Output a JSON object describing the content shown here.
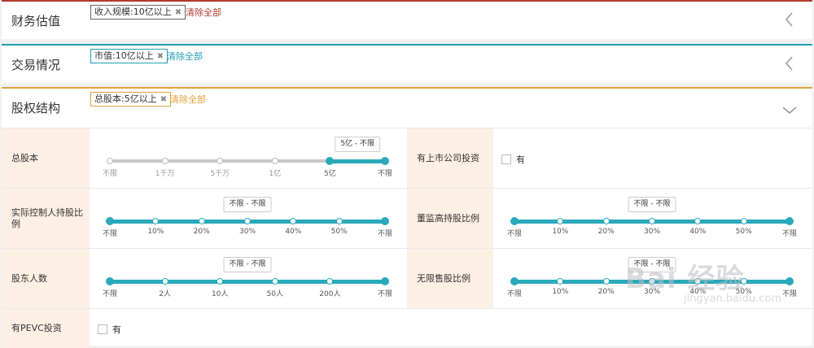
{
  "sections": {
    "finance": {
      "title": "财务估值",
      "chip": "收入规模:10亿以上",
      "clear": "清除全部",
      "color": "#b03a2e"
    },
    "trading": {
      "title": "交易情况",
      "chip": "市值:10亿以上",
      "clear": "清除全部",
      "color": "#1f9fb1"
    },
    "equity": {
      "title": "股权结构",
      "chip": "总股本:5亿以上",
      "clear": "清除全部",
      "color": "#e0a03a"
    }
  },
  "remove_icon": "close-icon",
  "accent_color": "#2aa9bb",
  "rows": {
    "total_shares": {
      "label": "总股本",
      "tooltip": "5亿 - 不限",
      "ticks": [
        "不限",
        "1千万",
        "5千万",
        "1亿",
        "5亿",
        "不限"
      ],
      "range": [
        4,
        5
      ]
    },
    "listed_investment": {
      "label": "有上市公司投资",
      "option": "有"
    },
    "controller": {
      "label": "实际控制人持股比例",
      "tooltip": "不限 - 不限",
      "ticks": [
        "不限",
        "10%",
        "20%",
        "30%",
        "40%",
        "50%",
        "不限"
      ],
      "range": [
        0,
        6
      ]
    },
    "executives": {
      "label": "董监高持股比例",
      "tooltip": "不限 - 不限",
      "ticks": [
        "不限",
        "10%",
        "20%",
        "30%",
        "40%",
        "50%",
        "不限"
      ],
      "range": [
        0,
        6
      ]
    },
    "holders": {
      "label": "股东人数",
      "tooltip": "不限 - 不限",
      "ticks": [
        "不限",
        "2人",
        "10人",
        "50人",
        "200人",
        "不限"
      ],
      "range": [
        0,
        5
      ]
    },
    "unrestricted": {
      "label": "无限售股比例",
      "tooltip": "不限 - 不限",
      "ticks": [
        "不限",
        "10%",
        "20%",
        "30%",
        "40%",
        "50%",
        "不限"
      ],
      "range": [
        0,
        6
      ]
    },
    "pevc": {
      "label": "有PEVC投资",
      "option": "有"
    }
  },
  "watermark": {
    "logo": "Bai 经验",
    "url": "jingyan.baidu.com"
  }
}
